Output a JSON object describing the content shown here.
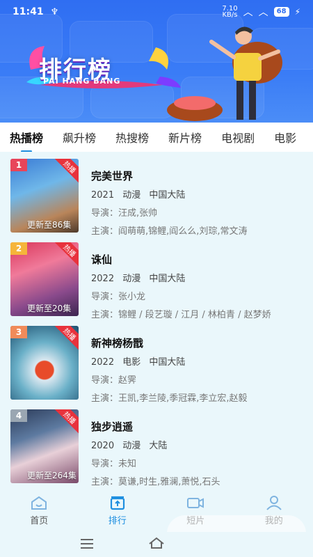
{
  "status_bar": {
    "time": "11:41",
    "speed": "7.10\nKB/s",
    "battery": "68"
  },
  "banner": {
    "title": "排行榜",
    "subtitle": "PAI HANG BANG"
  },
  "tabs": [
    {
      "label": "热播榜",
      "active": true
    },
    {
      "label": "飙升榜"
    },
    {
      "label": "热搜榜"
    },
    {
      "label": "新片榜"
    },
    {
      "label": "电视剧"
    },
    {
      "label": "电影"
    }
  ],
  "items": [
    {
      "rank": "1",
      "hot": "热播",
      "update": "更新至86集",
      "title": "完美世界",
      "year": "2021",
      "genre": "动漫",
      "region": "中国大陆",
      "director": "导演：汪成,张帅",
      "cast": "主演：阎萌萌,锦鲤,阎么么,刘琮,常文涛"
    },
    {
      "rank": "2",
      "hot": "热播",
      "update": "更新至20集",
      "title": "诛仙",
      "year": "2022",
      "genre": "动漫",
      "region": "中国大陆",
      "director": "导演：张小龙",
      "cast": "主演：锦鲤 / 段艺璇 / 江月 / 林柏青 / 赵梦娇"
    },
    {
      "rank": "3",
      "hot": "热播",
      "update": "",
      "title": "新神榜杨戬",
      "year": "2022",
      "genre": "电影",
      "region": "中国大陆",
      "director": "导演：赵霁",
      "cast": "主演：王凯,李兰陵,季冠霖,李立宏,赵毅"
    },
    {
      "rank": "4",
      "hot": "热播",
      "update": "更新至264集",
      "title": "独步逍遥",
      "year": "2020",
      "genre": "动漫",
      "region": "大陆",
      "director": "导演：未知",
      "cast": "主演：莫谦,时生,雅澜,萧悦,石头"
    }
  ],
  "nav": [
    {
      "label": "首页",
      "icon": "home-icon"
    },
    {
      "label": "排行",
      "icon": "ranking-icon",
      "active": true
    },
    {
      "label": "短片",
      "icon": "video-icon"
    },
    {
      "label": "我的",
      "icon": "profile-icon"
    }
  ],
  "colors": {
    "accent": "#1e8fe0",
    "banner": "#2f6ef2",
    "hot": "#e8323c",
    "rank1": "#e8455a",
    "rank2": "#f5b53a",
    "rank3": "#f08b5a",
    "rank4": "#9aa6b2"
  }
}
